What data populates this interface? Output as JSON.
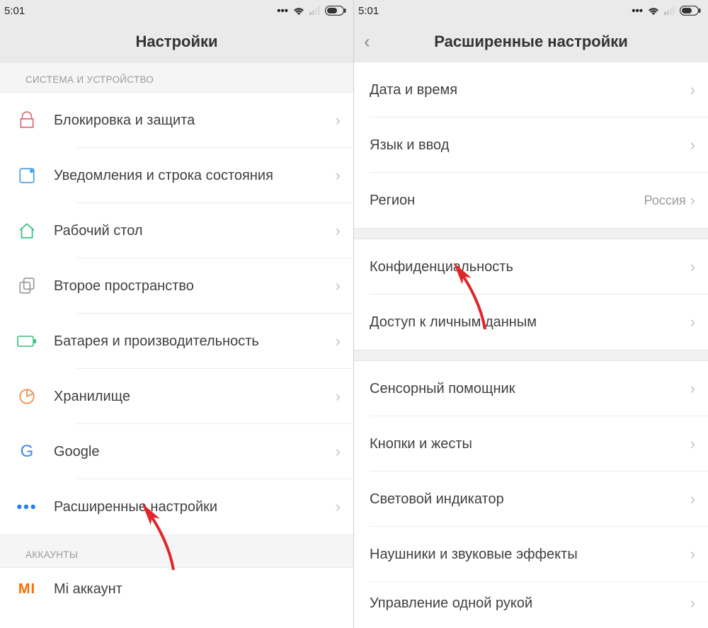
{
  "status": {
    "time": "5:01"
  },
  "left": {
    "title": "Настройки",
    "section1": "СИСТЕМА И УСТРОЙСТВО",
    "section2": "АККАУНТЫ",
    "items": [
      {
        "label": "Блокировка и защита"
      },
      {
        "label": "Уведомления и строка состояния"
      },
      {
        "label": "Рабочий стол"
      },
      {
        "label": "Второе пространство"
      },
      {
        "label": "Батарея и производительность"
      },
      {
        "label": "Хранилище"
      },
      {
        "label": "Google"
      },
      {
        "label": "Расширенные настройки"
      }
    ],
    "accounts": [
      {
        "label": "Mi аккаунт"
      }
    ]
  },
  "right": {
    "title": "Расширенные настройки",
    "groups": [
      [
        {
          "label": "Дата и время",
          "value": ""
        },
        {
          "label": "Язык и ввод",
          "value": ""
        },
        {
          "label": "Регион",
          "value": "Россия"
        }
      ],
      [
        {
          "label": "Конфиденциальность",
          "value": ""
        },
        {
          "label": "Доступ к личным данным",
          "value": ""
        }
      ],
      [
        {
          "label": "Сенсорный помощник",
          "value": ""
        },
        {
          "label": "Кнопки и жесты",
          "value": ""
        },
        {
          "label": "Световой индикатор",
          "value": ""
        },
        {
          "label": "Наушники и звуковые эффекты",
          "value": ""
        },
        {
          "label": "Управление одной рукой",
          "value": ""
        }
      ]
    ]
  }
}
